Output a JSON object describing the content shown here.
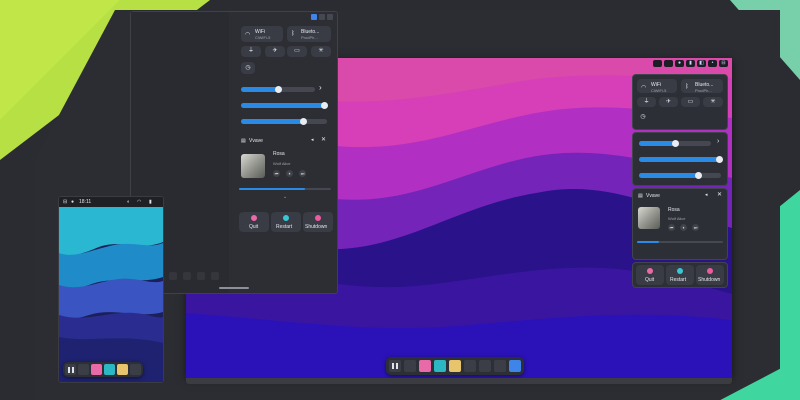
{
  "monitor": {
    "status_chips": [
      "",
      "",
      "●",
      "▮",
      "◧",
      "•",
      "⊟"
    ]
  },
  "quick_settings": {
    "wifi": {
      "title": "WiFi",
      "subtitle": "CiWiFi-5"
    },
    "bluetooth": {
      "title": "Blueto...",
      "subtitle": "ProdPh..."
    },
    "media": {
      "player": "Vvave",
      "track": "Rosa",
      "artist": "Wolf Alice"
    },
    "system": {
      "quit": "Quit",
      "restart": "Restart",
      "shutdown": "Shutdown"
    },
    "sliders": {
      "volume": 0.5,
      "brightness": 0.97,
      "mic": 0.72
    },
    "media_progress": 0.72
  },
  "phone": {
    "time": "18:11"
  },
  "colors": {
    "accent": "#2a8be6",
    "quit": "#e86aa8",
    "restart": "#38c7d6",
    "shutdown": "#ec5aa2"
  }
}
